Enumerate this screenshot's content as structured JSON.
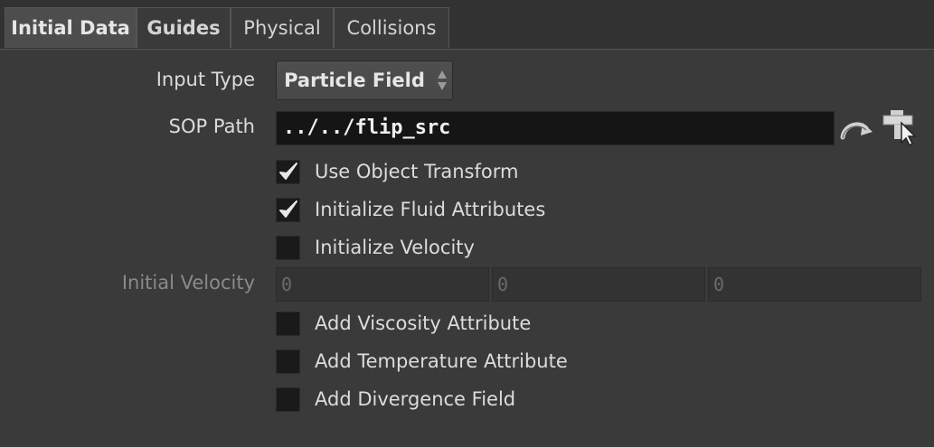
{
  "tabs": [
    {
      "label": "Initial Data",
      "active": true
    },
    {
      "label": "Guides",
      "active": false
    },
    {
      "label": "Physical",
      "active": false
    },
    {
      "label": "Collisions",
      "active": false
    }
  ],
  "input_type": {
    "label": "Input Type",
    "value": "Particle Field"
  },
  "sop_path": {
    "label": "SOP Path",
    "value": "../../flip_src"
  },
  "checkboxes": {
    "use_object_transform": {
      "label": "Use Object Transform",
      "checked": true
    },
    "init_fluid_attrs": {
      "label": "Initialize Fluid Attributes",
      "checked": true
    },
    "init_velocity": {
      "label": "Initialize Velocity",
      "checked": false
    },
    "add_viscosity": {
      "label": "Add Viscosity Attribute",
      "checked": false
    },
    "add_temperature": {
      "label": "Add Temperature Attribute",
      "checked": false
    },
    "add_divergence": {
      "label": "Add Divergence Field",
      "checked": false
    }
  },
  "initial_velocity": {
    "label": "Initial Velocity",
    "x": "0",
    "y": "0",
    "z": "0",
    "enabled": false
  },
  "icons": {
    "jump": "jump-to-operator-icon",
    "choose": "operator-chooser-icon"
  },
  "colors": {
    "background": "#3a3a3a",
    "field": "#151515",
    "active_tab": "#4d4d4d"
  }
}
